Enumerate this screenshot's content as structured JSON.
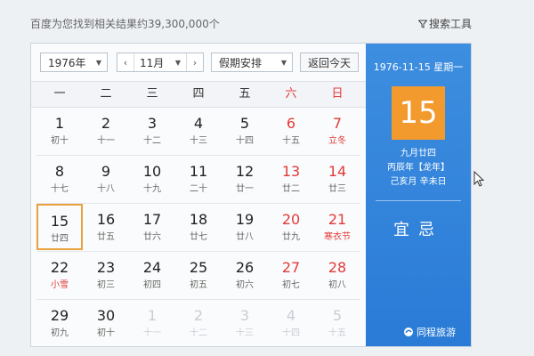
{
  "header": {
    "result_count": "百度为您找到相关结果约39,300,000个",
    "search_tools": "搜索工具",
    "filter_icon": "filter-icon"
  },
  "controls": {
    "year": "1976年",
    "month": "11月",
    "holiday": "假期安排",
    "today_button": "返回今天"
  },
  "weekdays": [
    {
      "label": "一",
      "weekend": false
    },
    {
      "label": "二",
      "weekend": false
    },
    {
      "label": "三",
      "weekend": false
    },
    {
      "label": "四",
      "weekend": false
    },
    {
      "label": "五",
      "weekend": false
    },
    {
      "label": "六",
      "weekend": true
    },
    {
      "label": "日",
      "weekend": true
    }
  ],
  "days": [
    {
      "day": "1",
      "lunar": "初十",
      "weekend": false,
      "term": false,
      "other": false,
      "selected": false
    },
    {
      "day": "2",
      "lunar": "十一",
      "weekend": false,
      "term": false,
      "other": false,
      "selected": false
    },
    {
      "day": "3",
      "lunar": "十二",
      "weekend": false,
      "term": false,
      "other": false,
      "selected": false
    },
    {
      "day": "4",
      "lunar": "十三",
      "weekend": false,
      "term": false,
      "other": false,
      "selected": false
    },
    {
      "day": "5",
      "lunar": "十四",
      "weekend": false,
      "term": false,
      "other": false,
      "selected": false
    },
    {
      "day": "6",
      "lunar": "十五",
      "weekend": true,
      "term": false,
      "other": false,
      "selected": false
    },
    {
      "day": "7",
      "lunar": "立冬",
      "weekend": true,
      "term": true,
      "other": false,
      "selected": false
    },
    {
      "day": "8",
      "lunar": "十七",
      "weekend": false,
      "term": false,
      "other": false,
      "selected": false
    },
    {
      "day": "9",
      "lunar": "十八",
      "weekend": false,
      "term": false,
      "other": false,
      "selected": false
    },
    {
      "day": "10",
      "lunar": "十九",
      "weekend": false,
      "term": false,
      "other": false,
      "selected": false
    },
    {
      "day": "11",
      "lunar": "二十",
      "weekend": false,
      "term": false,
      "other": false,
      "selected": false
    },
    {
      "day": "12",
      "lunar": "廿一",
      "weekend": false,
      "term": false,
      "other": false,
      "selected": false
    },
    {
      "day": "13",
      "lunar": "廿二",
      "weekend": true,
      "term": false,
      "other": false,
      "selected": false
    },
    {
      "day": "14",
      "lunar": "廿三",
      "weekend": true,
      "term": false,
      "other": false,
      "selected": false
    },
    {
      "day": "15",
      "lunar": "廿四",
      "weekend": false,
      "term": false,
      "other": false,
      "selected": true
    },
    {
      "day": "16",
      "lunar": "廿五",
      "weekend": false,
      "term": false,
      "other": false,
      "selected": false
    },
    {
      "day": "17",
      "lunar": "廿六",
      "weekend": false,
      "term": false,
      "other": false,
      "selected": false
    },
    {
      "day": "18",
      "lunar": "廿七",
      "weekend": false,
      "term": false,
      "other": false,
      "selected": false
    },
    {
      "day": "19",
      "lunar": "廿八",
      "weekend": false,
      "term": false,
      "other": false,
      "selected": false
    },
    {
      "day": "20",
      "lunar": "廿九",
      "weekend": true,
      "term": false,
      "other": false,
      "selected": false
    },
    {
      "day": "21",
      "lunar": "寒衣节",
      "weekend": true,
      "term": true,
      "other": false,
      "selected": false
    },
    {
      "day": "22",
      "lunar": "小雪",
      "weekend": false,
      "term": true,
      "other": false,
      "selected": false
    },
    {
      "day": "23",
      "lunar": "初三",
      "weekend": false,
      "term": false,
      "other": false,
      "selected": false
    },
    {
      "day": "24",
      "lunar": "初四",
      "weekend": false,
      "term": false,
      "other": false,
      "selected": false
    },
    {
      "day": "25",
      "lunar": "初五",
      "weekend": false,
      "term": false,
      "other": false,
      "selected": false
    },
    {
      "day": "26",
      "lunar": "初六",
      "weekend": false,
      "term": false,
      "other": false,
      "selected": false
    },
    {
      "day": "27",
      "lunar": "初七",
      "weekend": true,
      "term": false,
      "other": false,
      "selected": false
    },
    {
      "day": "28",
      "lunar": "初八",
      "weekend": true,
      "term": false,
      "other": false,
      "selected": false
    },
    {
      "day": "29",
      "lunar": "初九",
      "weekend": false,
      "term": false,
      "other": false,
      "selected": false
    },
    {
      "day": "30",
      "lunar": "初十",
      "weekend": false,
      "term": false,
      "other": false,
      "selected": false
    },
    {
      "day": "1",
      "lunar": "十一",
      "weekend": false,
      "term": false,
      "other": true,
      "selected": false
    },
    {
      "day": "2",
      "lunar": "十二",
      "weekend": false,
      "term": false,
      "other": true,
      "selected": false
    },
    {
      "day": "3",
      "lunar": "十三",
      "weekend": false,
      "term": false,
      "other": true,
      "selected": false
    },
    {
      "day": "4",
      "lunar": "十四",
      "weekend": true,
      "term": false,
      "other": true,
      "selected": false
    },
    {
      "day": "5",
      "lunar": "十五",
      "weekend": true,
      "term": false,
      "other": true,
      "selected": false
    }
  ],
  "side": {
    "date_line": "1976-11-15 星期一",
    "big_day": "15",
    "lunar_date": "九月廿四",
    "ganzhi_year": "丙辰年【龙年】",
    "ganzhi_month_day": "己亥月 辛未日",
    "yi": "宜",
    "ji": "忌",
    "brand": "同程旅游"
  },
  "colors": {
    "accent_blue": "#2a7bd6",
    "highlight_orange": "#f29a2e",
    "weekend_red": "#e23a3a"
  }
}
